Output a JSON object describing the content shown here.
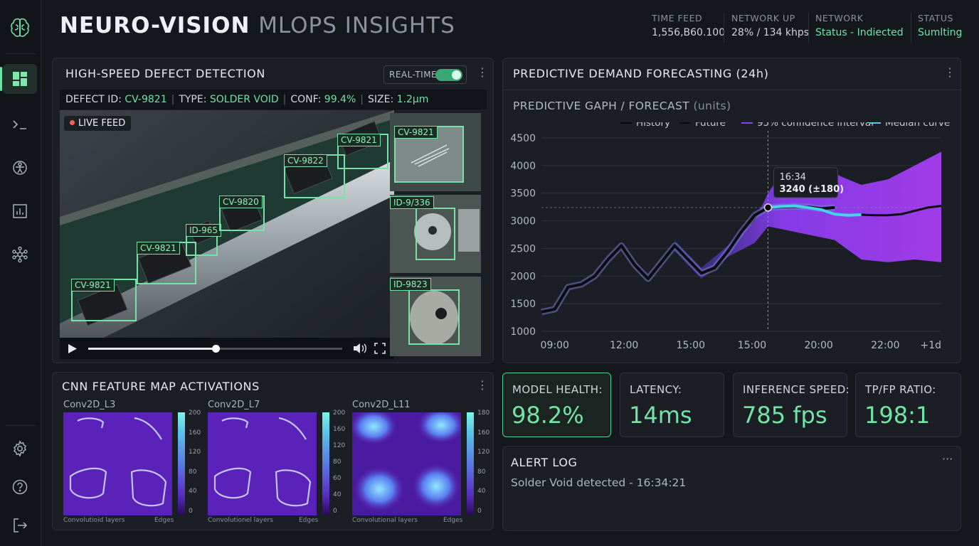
{
  "app": {
    "title_bold": "NEURO-VISION",
    "title_light": "MLOPS INSIGHTS"
  },
  "sidebar": {
    "items": [
      {
        "icon": "brain-logo-icon"
      },
      {
        "icon": "dashboard-icon",
        "active": true
      },
      {
        "icon": "terminal-icon"
      },
      {
        "icon": "model-icon"
      },
      {
        "icon": "bar-chart-icon"
      },
      {
        "icon": "network-icon"
      },
      {
        "icon": "settings-icon"
      },
      {
        "icon": "help-icon"
      },
      {
        "icon": "logout-icon"
      }
    ]
  },
  "header_stats": [
    {
      "label": "TIME FEED",
      "value": "1,556,B60.100"
    },
    {
      "label": "NETWORK UP",
      "value": "28% / 134 khps"
    },
    {
      "label": "NETWORK",
      "value": "Status - Indiecte​d"
    },
    {
      "label": "STATUS",
      "value": "Sumlting"
    }
  ],
  "defect_panel": {
    "title": "HIGH-SPEED DEFECT DETECTION",
    "toggle_label": "REAL-TIME",
    "toggle_on": true,
    "info": {
      "id_label": "DEFECT ID:",
      "id_value": "CV-9821",
      "type_label": "TYPE:",
      "type_value": "SOLDER VOID",
      "conf_label": "CONF:",
      "conf_value": "99.4%",
      "size_label": "SIZE:",
      "size_value": "1.2μm"
    },
    "live_label": "LIVE FEED",
    "detections": [
      "CV-9821",
      "CV-9821",
      "ID-965",
      "CV-9820",
      "CV-9822",
      "CV-9821"
    ],
    "thumbnails": [
      "CV-9821",
      "ID-9/336",
      "ID-9823"
    ],
    "playback_progress": 0.5
  },
  "forecast_panel": {
    "title": "PREDICTIVE DEMAND FORECASTING (24h)",
    "subtitle": "PREDICTIVE GAPH / FORECAST",
    "unit": "(units)",
    "tooltip_time": "16:34",
    "tooltip_value": "3240 (±180)"
  },
  "chart_data": {
    "type": "line",
    "title": "PREDICTIVE GAPH / FORECAST",
    "ylabel": "(units)",
    "ylim": [
      1000,
      4500
    ],
    "yticks": [
      1000,
      1500,
      2000,
      2500,
      3000,
      3500,
      4000,
      4500
    ],
    "xticks": [
      "09:00",
      "12:00",
      "15:00",
      "15:00",
      "20:00",
      "22:00",
      "+1d"
    ],
    "legend": [
      "History",
      "Future",
      "95% confidence interval",
      "Median curve"
    ],
    "legend_position": "top-right",
    "grid": true,
    "series": [
      {
        "name": "History",
        "x": [
          0,
          0.25,
          0.5,
          0.75,
          1,
          1.25,
          1.5,
          1.75,
          2,
          2.25,
          2.5,
          2.75,
          3,
          3.25,
          3.5,
          3.75,
          4,
          4.25,
          4.5,
          4.75,
          5,
          5.25,
          5.5
        ],
        "values": [
          1350,
          1400,
          1800,
          1850,
          2000,
          2300,
          2550,
          2200,
          1950,
          2250,
          2550,
          2300,
          2050,
          2150,
          2450,
          2800,
          3100,
          3240,
          3250,
          3260,
          3250,
          3220,
          3240
        ]
      },
      {
        "name": "Median curve",
        "x": [
          4.25,
          4.5,
          4.75,
          5,
          5.25,
          5.5,
          5.75,
          6
        ],
        "values": [
          3240,
          3260,
          3270,
          3240,
          3200,
          3120,
          3100,
          3110
        ]
      },
      {
        "name": "Future",
        "x": [
          6,
          6.25,
          6.5,
          6.75,
          7,
          7.25,
          7.5
        ],
        "values": [
          3110,
          3100,
          3100,
          3120,
          3180,
          3240,
          3270
        ]
      }
    ],
    "confidence_interval": {
      "name": "95% confidence interval",
      "x": [
        2.5,
        3,
        3.5,
        4,
        4.25,
        4.5,
        4.75,
        5,
        5.5,
        6,
        6.5,
        7,
        7.5
      ],
      "upper": [
        2650,
        2150,
        2550,
        3000,
        3500,
        3850,
        3920,
        3900,
        3850,
        3650,
        3750,
        4000,
        4250
      ],
      "lower": [
        2450,
        1950,
        2350,
        2600,
        2900,
        2850,
        2800,
        2750,
        2650,
        2300,
        2250,
        2300,
        2250
      ]
    },
    "highlight_point": {
      "x": 4.25,
      "value": 3240
    }
  },
  "feature_panel": {
    "title": "CNN FEATURE MAP ACTIVATIONS",
    "maps": [
      {
        "name": "Conv2D_L3",
        "ticks": [
          "200",
          "160",
          "120",
          "80",
          "40",
          "0"
        ],
        "caption_left": "Convolutioid layers",
        "caption_right": "Edges"
      },
      {
        "name": "Conv2D_L7",
        "ticks": [
          "200",
          "160",
          "120",
          "80",
          "60",
          "40",
          "0"
        ],
        "caption_left": "Convolutionel layers",
        "caption_right": "Edges"
      },
      {
        "name": "Conv2D_L11",
        "ticks": [
          "180",
          "160",
          "120",
          "80",
          "40",
          "0"
        ],
        "caption_left": "Convolutional layers",
        "caption_right": "Edges"
      }
    ]
  },
  "metrics": [
    {
      "label": "MODEL HEALTH:",
      "value": "98.2%"
    },
    {
      "label": "LATENCY:",
      "value": "14ms"
    },
    {
      "label": "INFERENCE SPEED:",
      "value": "785 fps"
    },
    {
      "label": "TP/FP RATIO:",
      "value": "198:1"
    }
  ],
  "alert_panel": {
    "title": "ALERT LOG",
    "entries": [
      "Solder Void detected - 16:34:21"
    ]
  },
  "colors": {
    "accent": "#6fe3a5",
    "background": "#14171c",
    "panel": "#1b1f25",
    "interval": "#8a3cf0",
    "median": "#3fd6ea"
  }
}
